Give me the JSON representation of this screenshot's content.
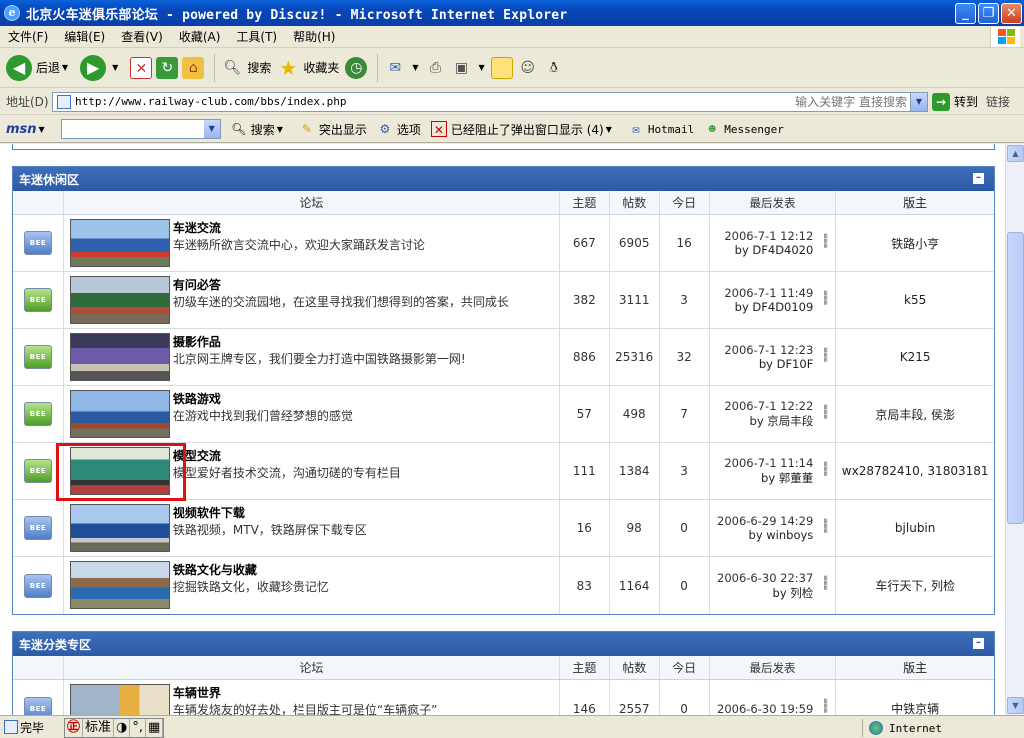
{
  "window": {
    "title": "北京火车迷俱乐部论坛 - powered by Discuz! - Microsoft Internet Explorer"
  },
  "menu": [
    "文件(F)",
    "编辑(E)",
    "查看(V)",
    "收藏(A)",
    "工具(T)",
    "帮助(H)"
  ],
  "toolbar": {
    "back": "后退",
    "search": "搜索",
    "favorites": "收藏夹"
  },
  "address": {
    "label": "地址(D)",
    "url": "http://www.railway-club.com/bbs/index.php",
    "keyword_placeholder": "输入关键字 直接搜索",
    "go": "转到",
    "links": "链接"
  },
  "msnbar": {
    "logo": "msn",
    "search": "搜索",
    "highlight": "突出显示",
    "options": "选项",
    "popup_blocked": "已经阻止了弹出窗口显示 (4)",
    "hotmail": "Hotmail",
    "messenger": "Messenger"
  },
  "columns": {
    "forum": "论坛",
    "topics": "主题",
    "posts": "帖数",
    "today": "今日",
    "last": "最后发表",
    "mod": "版主"
  },
  "sections": [
    {
      "title": "车迷休闲区",
      "forums": [
        {
          "name": "车迷交流",
          "desc": "车迷畅所欲言交流中心，欢迎大家踊跃发言讨论",
          "topics": "667",
          "posts": "6905",
          "today": "16",
          "last_date": "2006-7-1 12:12",
          "last_by": "by DF4D4020",
          "mod": "铁路小亨",
          "icon": "blue"
        },
        {
          "name": "有问必答",
          "desc": "初级车迷的交流园地，在这里寻找我们想得到的答案，共同成长",
          "topics": "382",
          "posts": "3111",
          "today": "3",
          "last_date": "2006-7-1 11:49",
          "last_by": "by DF4D0109",
          "mod": "k55",
          "icon": "green"
        },
        {
          "name": "摄影作品",
          "desc": "北京网王牌专区，我们要全力打造中国铁路摄影第一网!",
          "topics": "886",
          "posts": "25316",
          "today": "32",
          "last_date": "2006-7-1 12:23",
          "last_by": "by DF10F",
          "mod": "K215",
          "icon": "green"
        },
        {
          "name": "铁路游戏",
          "desc": "在游戏中找到我们曾经梦想的感觉",
          "topics": "57",
          "posts": "498",
          "today": "7",
          "last_date": "2006-7-1 12:22",
          "last_by": "by 京局丰段",
          "mod": "京局丰段, 侯澎",
          "icon": "green"
        },
        {
          "name": "模型交流",
          "desc": "模型爱好者技术交流，沟通切磋的专有栏目",
          "topics": "111",
          "posts": "1384",
          "today": "3",
          "last_date": "2006-7-1 11:14",
          "last_by": "by 郭董董",
          "mod": "wx28782410, 31803181",
          "icon": "green"
        },
        {
          "name": "视频软件下载",
          "desc": "铁路视频，MTV，铁路屏保下载专区",
          "topics": "16",
          "posts": "98",
          "today": "0",
          "last_date": "2006-6-29 14:29",
          "last_by": "by winboys",
          "mod": "bjlubin",
          "icon": "blue"
        },
        {
          "name": "铁路文化与收藏",
          "desc": "挖掘铁路文化，收藏珍贵记忆",
          "topics": "83",
          "posts": "1164",
          "today": "0",
          "last_date": "2006-6-30 22:37",
          "last_by": "by 列检",
          "mod": "车行天下, 列检",
          "icon": "blue"
        }
      ]
    },
    {
      "title": "车迷分类专区",
      "forums": [
        {
          "name": "车辆世界",
          "desc": "车辆发烧友的好去处，栏目版主可是位“车辆疯子”",
          "topics": "146",
          "posts": "2557",
          "today": "0",
          "last_date": "2006-6-30 19:59",
          "last_by": "",
          "mod": "中铁京辆",
          "icon": "blue"
        }
      ]
    }
  ],
  "statusbar": {
    "done": "完毕",
    "ime": "标准",
    "zone": "Internet"
  },
  "colors": {
    "header_blue": "#2c5aa6",
    "icon_green": "#4e9d28",
    "icon_blue": "#4f7ec8",
    "highlight_red": "#e01010"
  }
}
